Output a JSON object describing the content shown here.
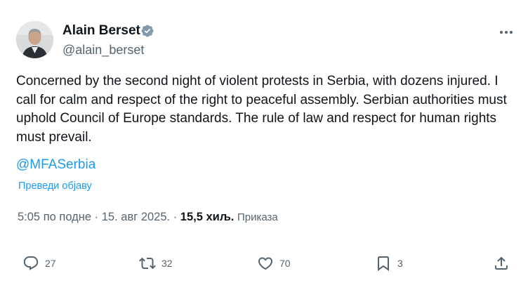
{
  "author": {
    "name": "Alain Berset",
    "handle": "@alain_berset",
    "verified": true
  },
  "tweet": {
    "text": "Concerned by the second night of violent protests in Serbia, with dozens injured. I call for calm and respect of the right to peaceful assembly. Serbian authorities must uphold Council of Europe standards. The rule of law and respect for human rights must prevail.",
    "mention": "@MFASerbia",
    "translate_label": "Преведи објаву"
  },
  "meta": {
    "time": "5:05 по подне",
    "separator": "·",
    "date": "15. авг 2025.",
    "views_count": "15,5 хиљ.",
    "views_label": "Приказа"
  },
  "actions": {
    "replies": "27",
    "reposts": "32",
    "likes": "70",
    "bookmarks": "3"
  },
  "colors": {
    "accent": "#1d9bf0",
    "text": "#0f1419",
    "secondary": "#536471",
    "verified": "#829aab"
  },
  "icons": {
    "more": "more-horizontal-icon",
    "verified": "verified-badge-icon",
    "reply": "reply-icon",
    "repost": "repost-icon",
    "like": "heart-icon",
    "bookmark": "bookmark-icon",
    "share": "share-icon"
  }
}
